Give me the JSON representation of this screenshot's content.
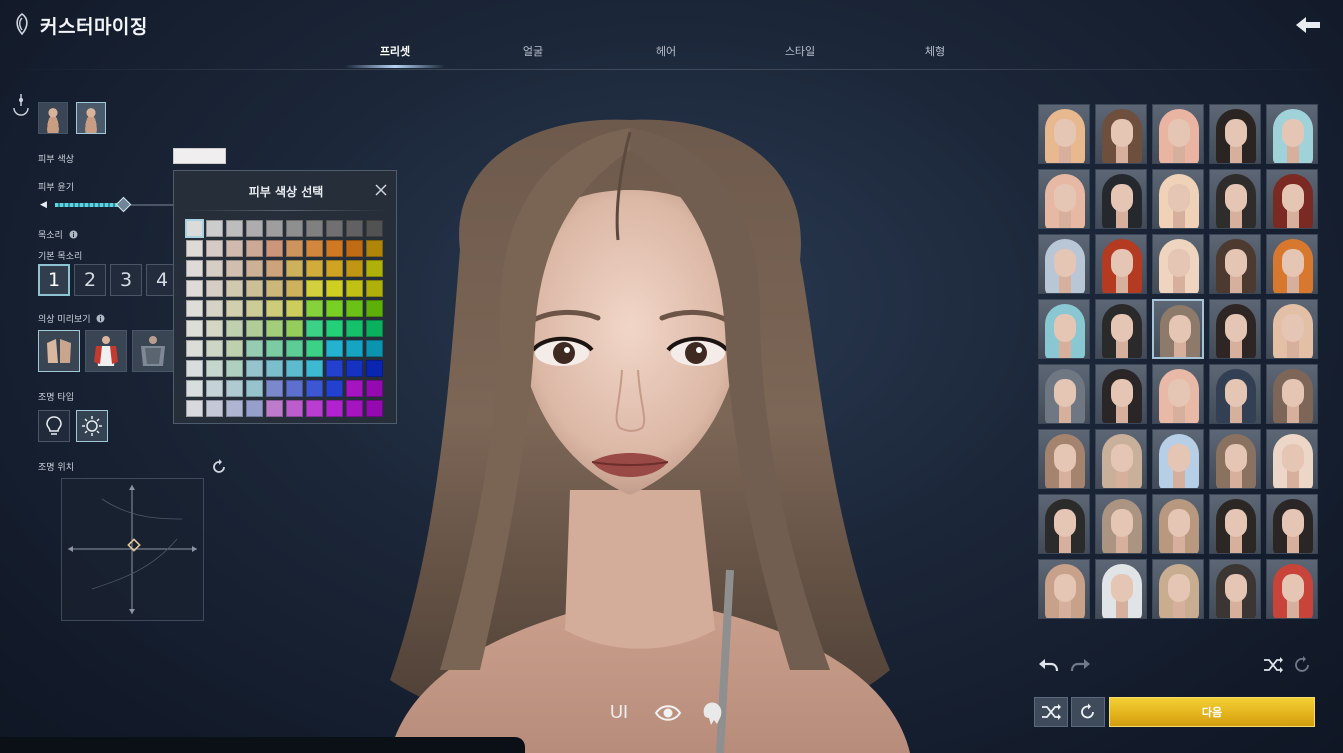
{
  "header": {
    "title": "커스터마이징",
    "tabs": [
      {
        "label": "프리셋",
        "active": true
      },
      {
        "label": "얼굴",
        "active": false
      },
      {
        "label": "헤어",
        "active": false
      },
      {
        "label": "스타일",
        "active": false
      },
      {
        "label": "체형",
        "active": false
      }
    ],
    "back_icon": "arrow-left-icon",
    "logo_icon": "crest-icon"
  },
  "left_panel": {
    "skin_color_label": "피부 색상",
    "skin_gloss_label": "피부 윤기",
    "skin_gloss_value": 0.55,
    "voice_label": "목소리",
    "base_voice_label": "기본 목소리",
    "voice_options": [
      "1",
      "2",
      "3",
      "4"
    ],
    "voice_selected": "1",
    "outfit_preview_label": "의상 미리보기",
    "lighting_type_label": "조명 타입",
    "lighting_position_label": "조명 위치",
    "info_icon": "info-icon"
  },
  "skin_popup": {
    "title": "피부 색상 선택",
    "close_icon": "close-icon",
    "selected_index": 0
  },
  "view_toggles": {
    "ui_label": "UI",
    "eye_icon": "eye-icon",
    "hair_icon": "hair-icon"
  },
  "preset_panel": {
    "selected_index": 17,
    "undo_icon": "undo-icon",
    "redo_icon": "redo-icon",
    "shuffle_icon": "shuffle-icon",
    "reset_icon": "reset-icon"
  },
  "footer": {
    "next_label": "다음"
  },
  "colors": {
    "accent": "#8fc3cf",
    "next_button": "#e2b21b",
    "background": "#1b2638"
  }
}
